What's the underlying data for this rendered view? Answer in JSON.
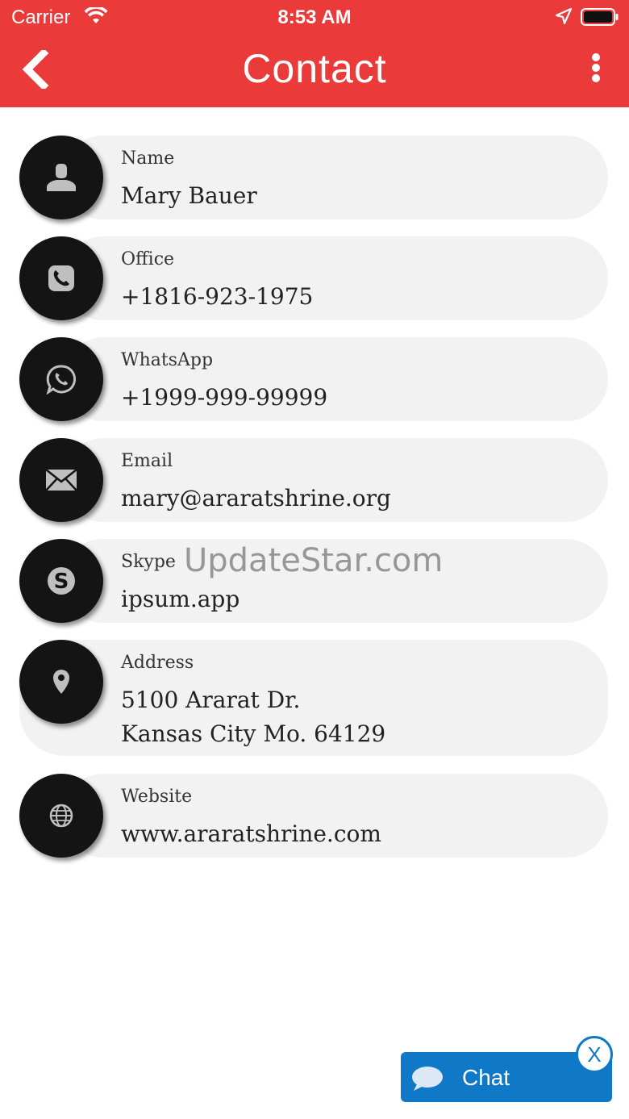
{
  "status_bar": {
    "carrier": "Carrier",
    "time": "8:53 AM"
  },
  "header": {
    "title": "Contact"
  },
  "contacts": [
    {
      "label": "Name",
      "value": "Mary Bauer",
      "icon": "person-icon"
    },
    {
      "label": "Office",
      "value": "+1816-923-1975",
      "icon": "phone-icon"
    },
    {
      "label": "WhatsApp",
      "value": "+1999-999-99999",
      "icon": "whatsapp-icon"
    },
    {
      "label": "Email",
      "value": "mary@araratshrine.org",
      "icon": "mail-icon"
    },
    {
      "label": "Skype",
      "value": "ipsum.app",
      "icon": "skype-icon"
    },
    {
      "label": "Address",
      "value_line1": "5100 Ararat Dr.",
      "value_line2": "Kansas City Mo. 64129",
      "icon": "location-pin-icon"
    },
    {
      "label": "Website",
      "value": "www.araratshrine.com",
      "icon": "globe-icon"
    }
  ],
  "watermark": "UpdateStar.com",
  "chat": {
    "label": "Chat",
    "close_label": "X"
  },
  "colors": {
    "header": "#ea3a3a",
    "row_bg": "#f2f2f2",
    "icon_circle": "#141414",
    "chat": "#0f79c8"
  }
}
